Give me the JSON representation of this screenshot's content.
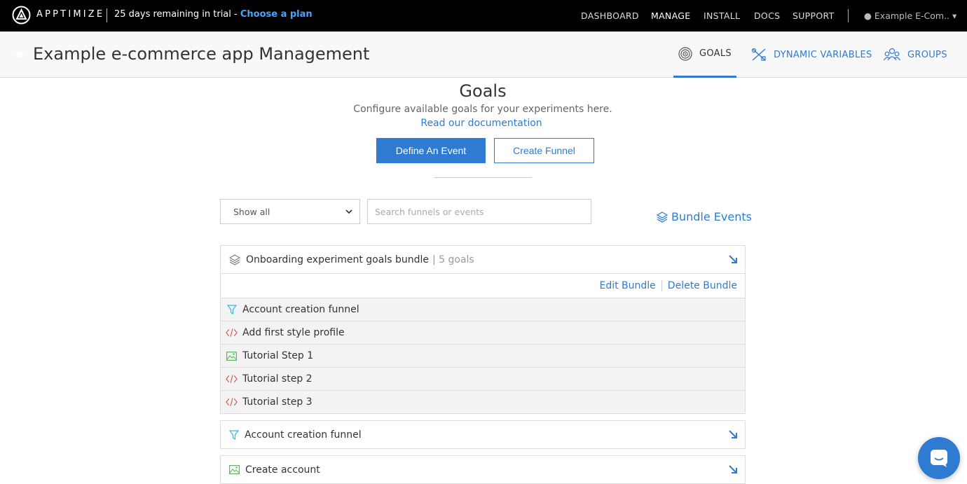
{
  "topbar": {
    "brand": "APPTIMIZE",
    "trial_text": "25 days remaining in trial - ",
    "trial_link": "Choose a plan",
    "nav": [
      "DASHBOARD",
      "MANAGE",
      "INSTALL",
      "DOCS",
      "SUPPORT"
    ],
    "active_nav": "MANAGE",
    "app_switcher": "Example E-Com.."
  },
  "subheader": {
    "title": "Example e-commerce app Management",
    "tabs": [
      {
        "label": "GOALS",
        "icon": "target-icon",
        "active": true
      },
      {
        "label": "DYNAMIC VARIABLES",
        "icon": "tools-icon",
        "active": false
      },
      {
        "label": "GROUPS",
        "icon": "groups-icon",
        "active": false
      }
    ]
  },
  "main": {
    "heading": "Goals",
    "subtitle": "Configure available goals for your experiments here.",
    "docs_link": "Read our documentation",
    "define_event_label": "Define An Event",
    "create_funnel_label": "Create Funnel",
    "filter_value": "Show all",
    "search_placeholder": "Search funnels or events",
    "bundle_events_label": "Bundle Events"
  },
  "bundle": {
    "name": "Onboarding experiment goals bundle",
    "count": "| 5 goals",
    "edit_label": "Edit Bundle",
    "delete_label": "Delete Bundle",
    "goals": [
      {
        "label": "Account creation funnel",
        "icon": "funnel-icon"
      },
      {
        "label": "Add first style profile",
        "icon": "code-icon"
      },
      {
        "label": "Tutorial Step 1",
        "icon": "image-icon"
      },
      {
        "label": "Tutorial step 2",
        "icon": "code-icon"
      },
      {
        "label": "Tutorial step 3",
        "icon": "code-icon"
      }
    ]
  },
  "goals": [
    {
      "label": "Account creation funnel",
      "icon": "funnel-icon"
    },
    {
      "label": "Create account",
      "icon": "image-icon"
    }
  ],
  "colors": {
    "accent": "#2e7bd1",
    "funnel": "#3bb5d8",
    "code": "#d9534f",
    "image": "#5cb85c"
  }
}
